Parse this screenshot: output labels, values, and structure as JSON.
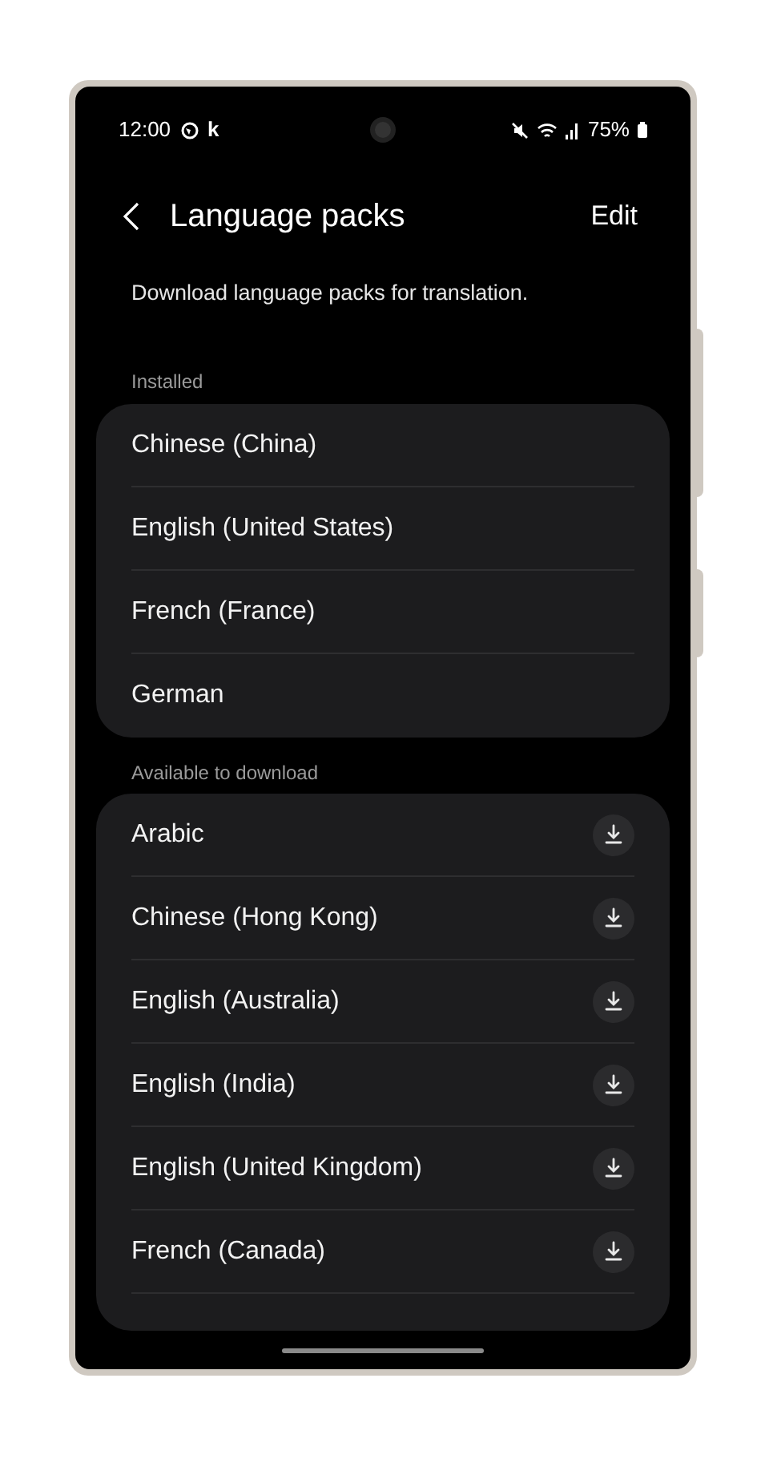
{
  "status_bar": {
    "time": "12:00",
    "app_glyph": "k",
    "battery": "75%"
  },
  "header": {
    "title": "Language packs",
    "action": "Edit"
  },
  "description": "Download language packs for translation.",
  "sections": [
    {
      "title": "Installed",
      "items": [
        {
          "name": "Chinese (China)",
          "kind": "installed"
        },
        {
          "name": "English (United States)",
          "kind": "installed"
        },
        {
          "name": "French (France)",
          "kind": "installed"
        },
        {
          "name": "German",
          "kind": "installed"
        }
      ]
    },
    {
      "title": "Available to download",
      "items": [
        {
          "name": "Arabic",
          "kind": "download"
        },
        {
          "name": "Chinese (Hong Kong)",
          "kind": "download"
        },
        {
          "name": "English (Australia)",
          "kind": "download"
        },
        {
          "name": "English (India)",
          "kind": "download"
        },
        {
          "name": "English (United Kingdom)",
          "kind": "download"
        },
        {
          "name": "French (Canada)",
          "kind": "download"
        }
      ]
    }
  ]
}
